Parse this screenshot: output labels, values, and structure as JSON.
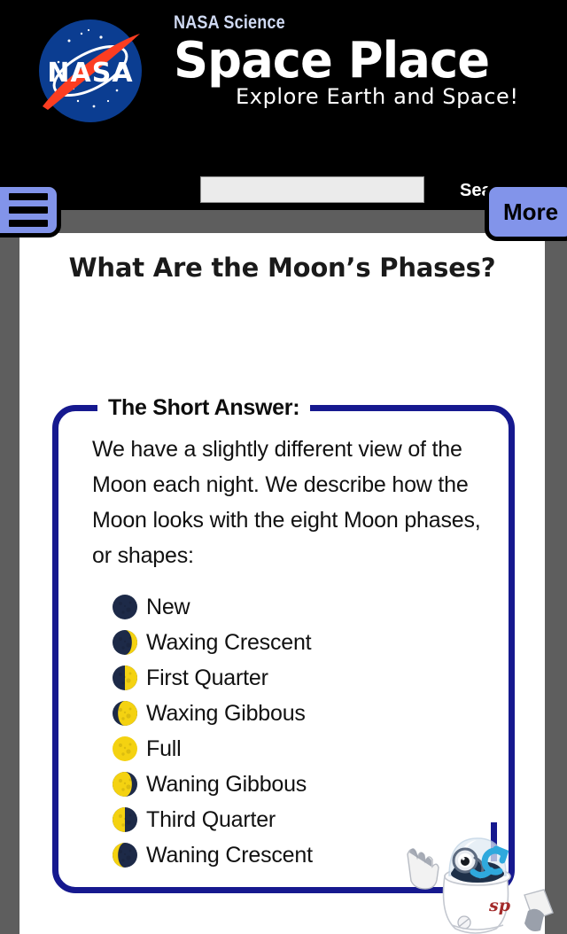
{
  "header": {
    "logo_alt": "NASA insignia",
    "eyebrow": "NASA Science",
    "wordmark": "Space Place",
    "tagline": "Explore Earth and Space!",
    "background_color": "#000000"
  },
  "nav": {
    "menu_button_name": "menu",
    "more_button_label": "More",
    "button_color": "#8294ea",
    "bar_color": "#5e5e5e"
  },
  "search": {
    "value": "",
    "placeholder": "",
    "submit_label": "Search",
    "submit_label_visible": "Sea"
  },
  "main": {
    "page_title": "What Are the Moon’s Phases?",
    "short_answer": {
      "legend": "The Short Answer:",
      "paragraph": "We have a slightly different view of the Moon each night. We describe how the Moon looks with the eight Moon phases, or shapes:",
      "border_color": "#16198f",
      "phases": [
        {
          "label": "New",
          "icon": "moon-new-icon",
          "lit": 0.0,
          "lit_side": "none"
        },
        {
          "label": "Waxing Crescent",
          "icon": "moon-waxing-crescent-icon",
          "lit": 0.22,
          "lit_side": "right"
        },
        {
          "label": "First Quarter",
          "icon": "moon-first-quarter-icon",
          "lit": 0.5,
          "lit_side": "right"
        },
        {
          "label": "Waxing Gibbous",
          "icon": "moon-waxing-gibbous-icon",
          "lit": 0.78,
          "lit_side": "right"
        },
        {
          "label": "Full",
          "icon": "moon-full-icon",
          "lit": 1.0,
          "lit_side": "all"
        },
        {
          "label": "Waning Gibbous",
          "icon": "moon-waning-gibbous-icon",
          "lit": 0.78,
          "lit_side": "left"
        },
        {
          "label": "Third Quarter",
          "icon": "moon-third-quarter-icon",
          "lit": 0.5,
          "lit_side": "left"
        },
        {
          "label": "Waning Crescent",
          "icon": "moon-waning-crescent-icon",
          "lit": 0.22,
          "lit_side": "left"
        }
      ],
      "moon_lit_color": "#f4d211",
      "moon_dark_color": "#1d2a48"
    }
  },
  "mascot": {
    "name": "space-place-robot",
    "body_badge": "sp"
  }
}
